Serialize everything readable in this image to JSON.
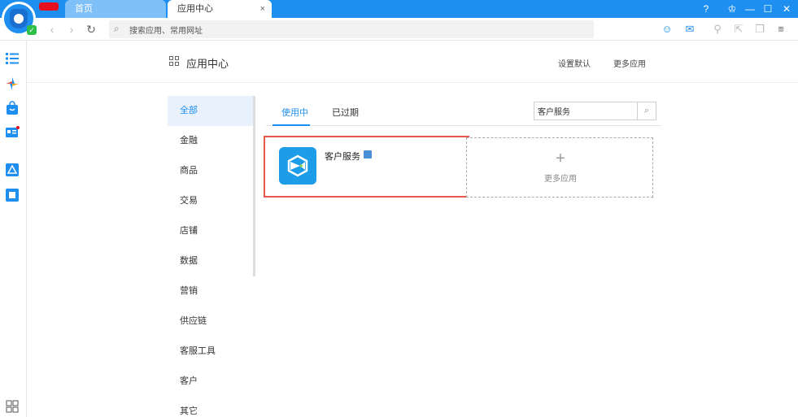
{
  "browser": {
    "tabs": [
      {
        "label": "首页"
      },
      {
        "label": "应用中心",
        "close": "×"
      }
    ],
    "window_controls": [
      "?",
      "♔",
      "—",
      "☐",
      "✕"
    ],
    "address": {
      "placeholder": "搜索应用、常用网址"
    }
  },
  "sidebar_icons": [
    "list-icon",
    "pinwheel-icon",
    "shopping-bag-icon",
    "id-card-icon",
    "triangle-app-icon",
    "square-app-icon",
    "grid-apps-icon"
  ],
  "header": {
    "title": "应用中心",
    "links": {
      "settings": "设置默认",
      "more": "更多应用"
    }
  },
  "categories": [
    {
      "label": "全部",
      "active": true
    },
    {
      "label": "金融"
    },
    {
      "label": "商品"
    },
    {
      "label": "交易"
    },
    {
      "label": "店铺"
    },
    {
      "label": "数据"
    },
    {
      "label": "营销"
    },
    {
      "label": "供应链"
    },
    {
      "label": "客服工具"
    },
    {
      "label": "客户"
    },
    {
      "label": "其它"
    }
  ],
  "subtabs": {
    "in_use": "使用中",
    "expired": "已过期"
  },
  "app_search": {
    "value": "客户服务"
  },
  "apps": [
    {
      "name": "客户服务"
    }
  ],
  "add_card": {
    "plus": "+",
    "label": "更多应用"
  },
  "colors": {
    "accent": "#1e8ff0",
    "highlight_border": "#e8574a",
    "app_icon": "#1d9ce8"
  }
}
